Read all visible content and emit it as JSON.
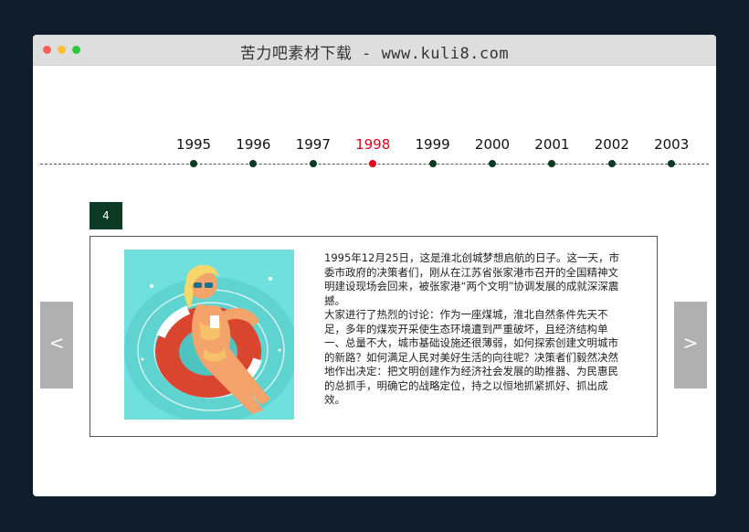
{
  "window": {
    "title": "苦力吧素材下载 - www.kuli8.com"
  },
  "timeline": {
    "years": [
      "1995",
      "1996",
      "1997",
      "1998",
      "1999",
      "2000",
      "2001",
      "2002",
      "2003"
    ],
    "active_index": 3,
    "active_color": "#e3001b",
    "node_color": "#0c3a24"
  },
  "slide": {
    "badge": "4",
    "paragraphs": [
      "1995年12月25日，这是淮北创城梦想启航的日子。这一天，市委市政府的决策者们，刚从在江苏省张家港市召开的全国精神文明建设现场会回来，被张家港“两个文明”协调发展的成就深深震撼。",
      "大家进行了热烈的讨论：作为一座煤城，淮北自然条件先天不足，多年的煤炭开采使生态环境遭到严重破坏，且经济结构单一、总量不大，城市基础设施还很薄弱，如何探索创建文明城市的新路？如何满足人民对美好生活的向往呢？决策者们毅然决然地作出决定：把文明创建作为经济社会发展的助推器、为民惠民的总抓手，明确它的战略定位，持之以恒地抓紧抓好、抓出成效。"
    ]
  },
  "nav": {
    "prev": "<",
    "next": ">"
  }
}
